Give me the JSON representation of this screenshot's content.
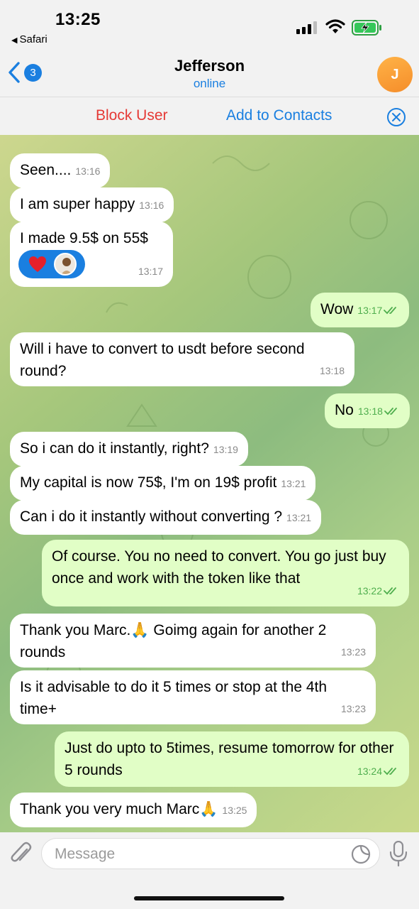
{
  "status_bar": {
    "time": "13:25",
    "back_app": "Safari"
  },
  "header": {
    "back_count": "3",
    "title": "Jefferson",
    "status": "online",
    "avatar_initial": "J"
  },
  "actions": {
    "block_user": "Block User",
    "add_to_contacts": "Add to Contacts"
  },
  "messages": [
    {
      "dir": "in",
      "text": "Seen....",
      "time": "13:16"
    },
    {
      "dir": "in",
      "text": "I am super happy",
      "time": "13:16"
    },
    {
      "dir": "in",
      "text": "I made 9.5$ on 55$",
      "time": "13:17"
    },
    {
      "dir": "out",
      "text": "Wow",
      "time": "13:17"
    },
    {
      "dir": "in",
      "text": "Will i have to convert to usdt before second round?",
      "time": "13:18"
    },
    {
      "dir": "out",
      "text": "No",
      "time": "13:18"
    },
    {
      "dir": "in",
      "text": "So i can do it instantly, right?",
      "time": "13:19"
    },
    {
      "dir": "in",
      "text": "My capital is now 75$, I'm on 19$ profit",
      "time": "13:21"
    },
    {
      "dir": "in",
      "text": "Can i do it instantly without converting ?",
      "time": "13:21"
    },
    {
      "dir": "out",
      "text": "Of course. You no need to convert. You go just buy once and work with the token like that",
      "time": "13:22"
    },
    {
      "dir": "in",
      "text": "Thank you Marc.🙏 Goimg again for another 2 rounds",
      "time": "13:23"
    },
    {
      "dir": "in",
      "text": "Is it advisable to do it 5 times or stop at the 4th time+",
      "time": "13:23"
    },
    {
      "dir": "out",
      "text": "Just do upto to 5times, resume tomorrow for other 5 rounds",
      "time": "13:24"
    },
    {
      "dir": "in",
      "text": "Thank you very much Marc🙏",
      "time": "13:25"
    }
  ],
  "input": {
    "placeholder": "Message"
  },
  "colors": {
    "accent": "#1a7fe0",
    "danger": "#e53935",
    "outgoing_bubble": "#e1fec6",
    "incoming_bubble": "#ffffff"
  }
}
